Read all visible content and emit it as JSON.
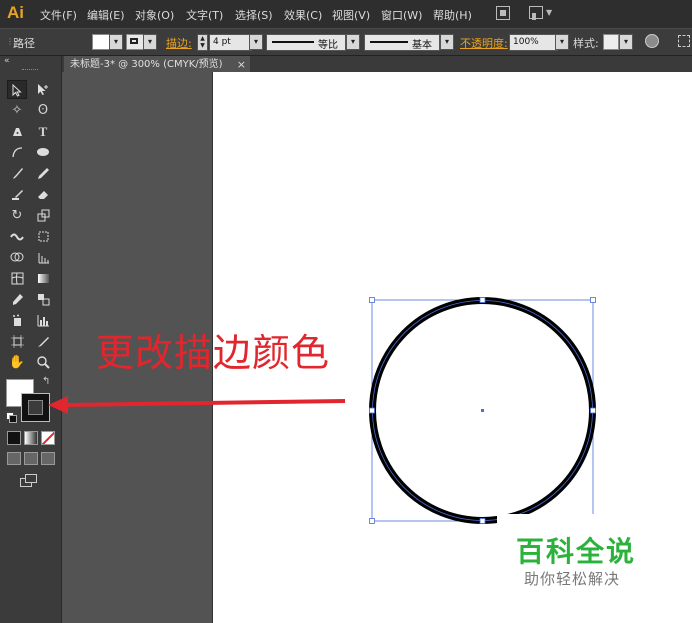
{
  "app": {
    "logo": "Ai"
  },
  "menubar": {
    "items": [
      "文件(F)",
      "编辑(E)",
      "对象(O)",
      "文字(T)",
      "选择(S)",
      "效果(C)",
      "视图(V)",
      "窗口(W)",
      "帮助(H)"
    ]
  },
  "options_bar": {
    "object_type": "路径",
    "stroke_label": "描边:",
    "stroke_weight": "4 pt",
    "profile_label": "等比",
    "brush_label": "基本",
    "opacity_label": "不透明度:",
    "opacity_value": "100%",
    "style_label": "样式:"
  },
  "document": {
    "tab_title": "未标题-3* @ 300% (CMYK/预览)",
    "close_glyph": "×"
  },
  "toolbox": {
    "collapse_glyph": "«"
  },
  "annotation": {
    "text": "更改描边颜色"
  },
  "watermark": {
    "title": "百科全说",
    "subtitle": "助你轻松解决"
  },
  "colors": {
    "accent_orange": "#e8a322",
    "annotation_red": "#e1262d",
    "watermark_green": "#2bb23c",
    "selection_blue": "#4a6fd8"
  }
}
